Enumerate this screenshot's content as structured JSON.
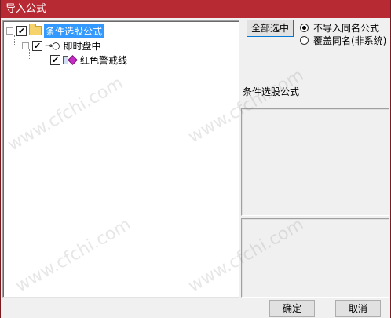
{
  "window": {
    "title": "导入公式"
  },
  "tree": {
    "root": {
      "label": "条件选股公式",
      "checked": true
    },
    "child": {
      "label": "即时盘中",
      "checked": true
    },
    "leaf": {
      "label": "红色警戒线一",
      "checked": true
    }
  },
  "side": {
    "select_all_label": "全部选中",
    "radio_no_import": "不导入同名公式",
    "radio_overwrite": "覆盖同名(非系统)",
    "info_label": "条件选股公式"
  },
  "footer": {
    "ok_label": "确定",
    "cancel_label": "取消"
  },
  "watermark": "www.cfchi.com",
  "colors": {
    "titlebar": "#b72a34",
    "selection": "#3399ff"
  }
}
